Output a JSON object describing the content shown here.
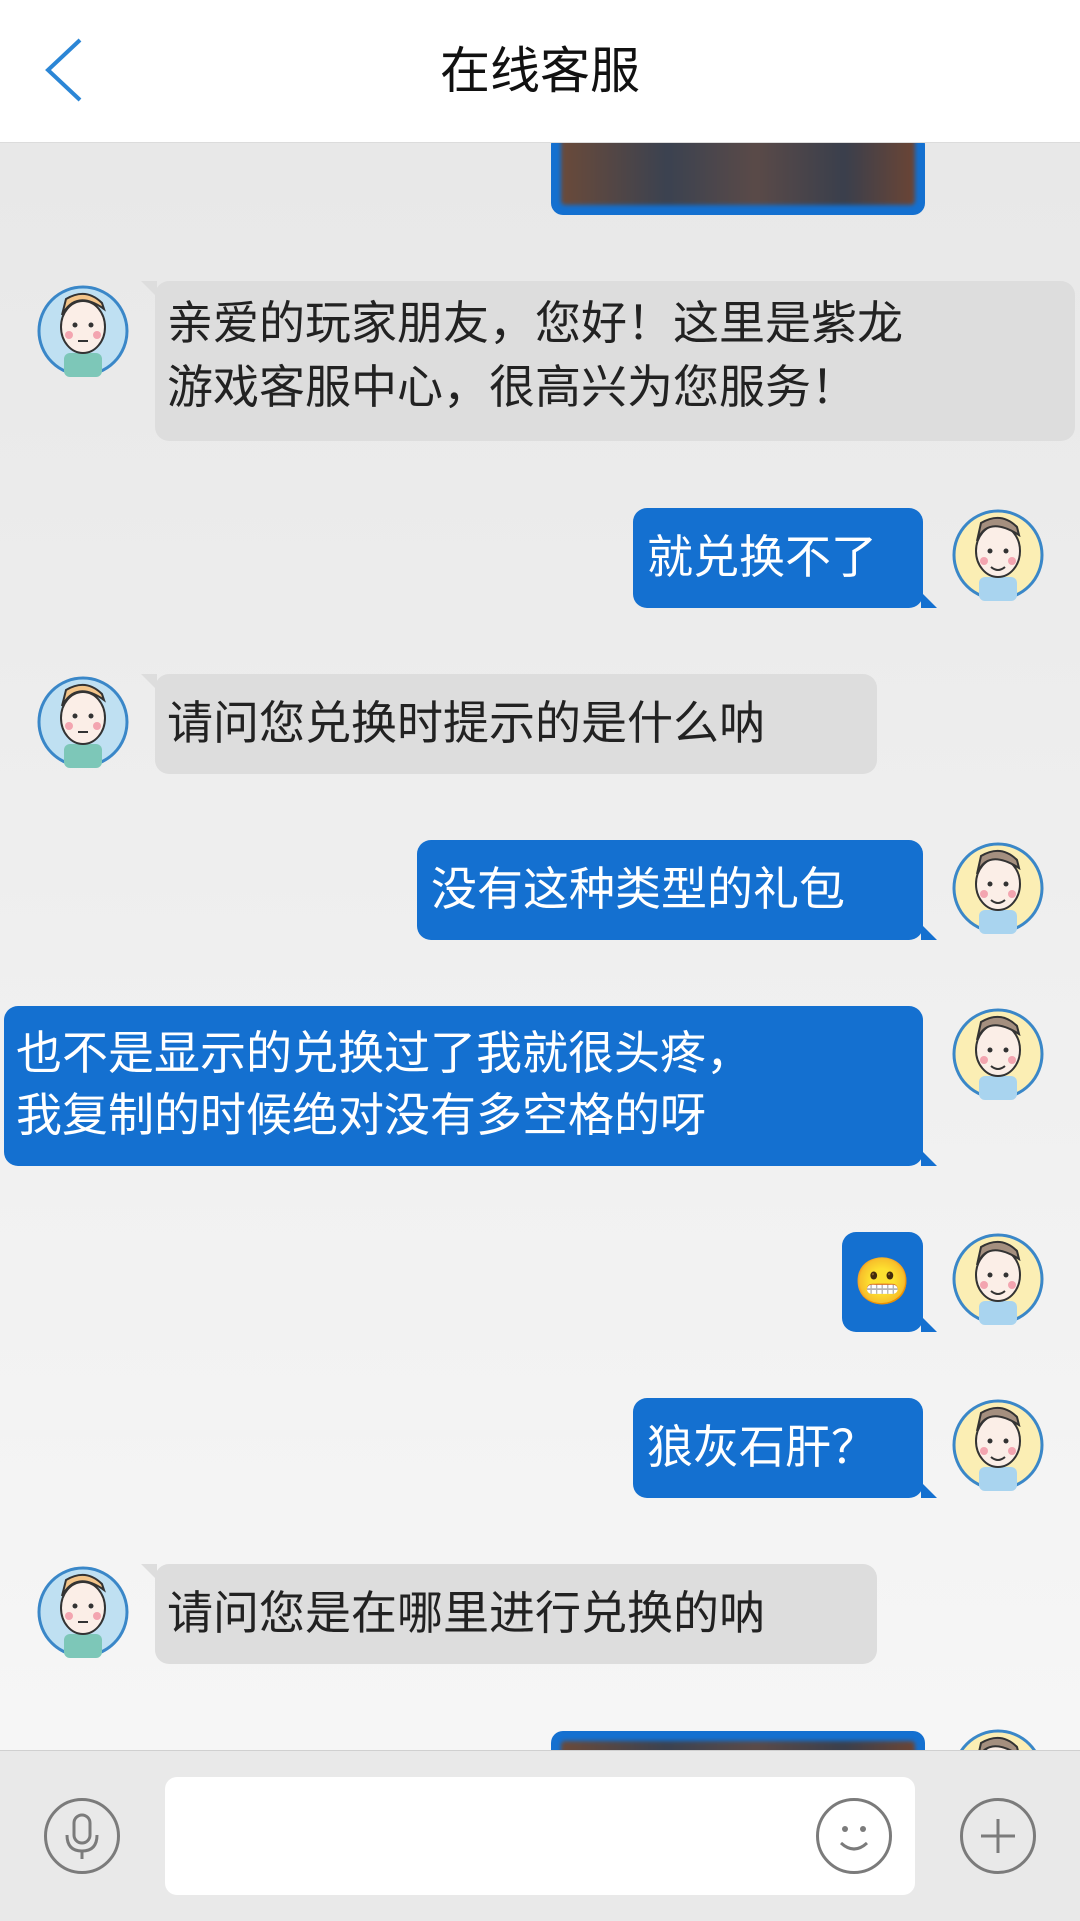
{
  "header": {
    "title": "在线客服"
  },
  "messages": [
    {
      "side": "in",
      "lines": [
        "亲爱的玩家朋友，您好！这里是紫龙",
        "游戏客服中心，很高兴为您服务！"
      ]
    },
    {
      "side": "out",
      "lines": [
        "就兑换不了"
      ]
    },
    {
      "side": "in",
      "lines": [
        "请问您兑换时提示的是什么呐"
      ]
    },
    {
      "side": "out",
      "lines": [
        "没有这种类型的礼包"
      ]
    },
    {
      "side": "out",
      "lines": [
        "也不是显示的兑换过了我就很头疼，",
        "我复制的时候绝对没有多空格的呀"
      ]
    },
    {
      "side": "out",
      "emoji": "😬"
    },
    {
      "side": "out",
      "lines": [
        "狼灰石肝？"
      ]
    },
    {
      "side": "in",
      "lines": [
        "请问您是在哪里进行兑换的呐"
      ]
    }
  ],
  "input": {
    "value": ""
  },
  "icons": {
    "back": "back-icon",
    "mic": "microphone-icon",
    "emoji": "smiley-icon",
    "plus": "plus-icon"
  },
  "colors": {
    "accent": "#1470d0",
    "incoming": "#dddddd"
  }
}
